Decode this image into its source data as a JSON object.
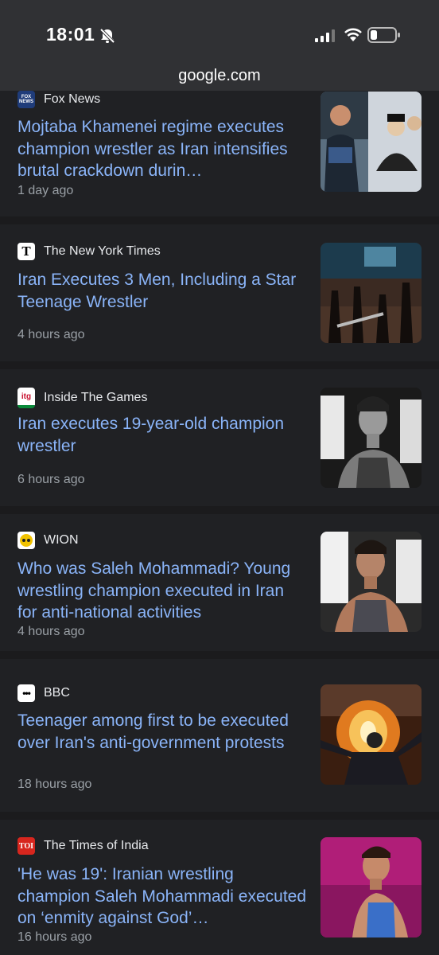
{
  "status": {
    "time": "18:01"
  },
  "browser": {
    "url": "google.com"
  },
  "articles": [
    {
      "source": "Fox News",
      "title": "Mojtaba Khamenei regime executes champion wrestler as Iran intensifies brutal crackdown durin…",
      "time": "1 day ago",
      "logo_text": "FOX NEWS"
    },
    {
      "source": "The New York Times",
      "title": "Iran Executes 3 Men, Including a Star Teenage Wrestler",
      "time": "4 hours ago",
      "logo_text": "T"
    },
    {
      "source": "Inside The Games",
      "title": "Iran executes 19-year-old champion wrestler",
      "time": "6 hours ago",
      "logo_text": "itg"
    },
    {
      "source": "WION",
      "title": "Who was Saleh Mohammadi? Young wrestling champion executed in Iran for anti-national activities",
      "time": "4 hours ago",
      "logo_text": ""
    },
    {
      "source": "BBC",
      "title": "Teenager among first to be executed over Iran's anti-government protests",
      "time": "18 hours ago",
      "logo_text": "•••"
    },
    {
      "source": "The Times of India",
      "title": "'He was 19': Iranian wrestling champion Saleh Mohammadi executed on ‘enmity against God’…",
      "time": "16 hours ago",
      "logo_text": "TOI"
    }
  ]
}
